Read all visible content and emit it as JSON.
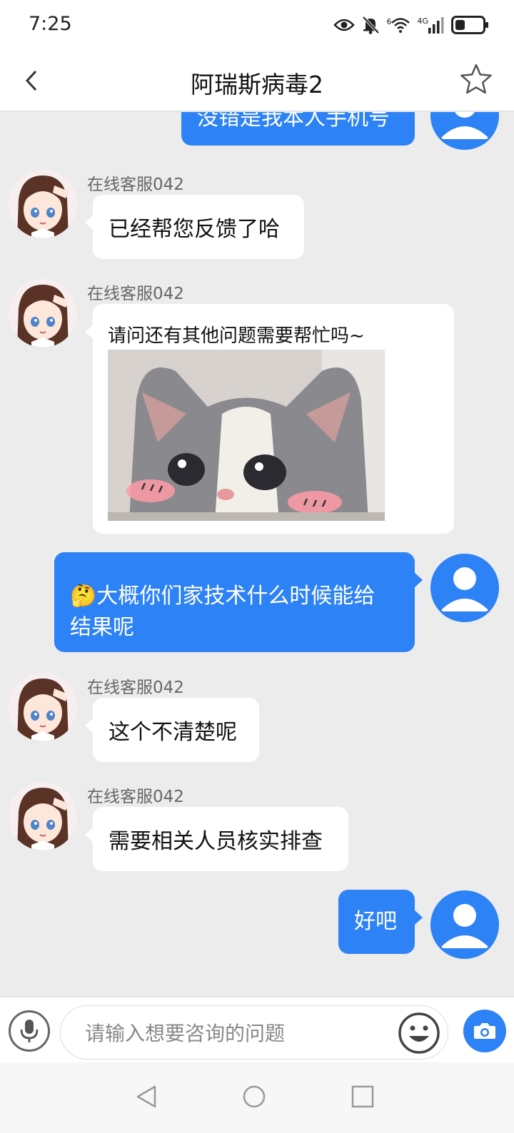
{
  "status_bar": {
    "time": "7:25",
    "signal_label": "4G",
    "wifi_label": "6",
    "battery_level": 0.35
  },
  "header": {
    "title": "阿瑞斯病毒2"
  },
  "messages": [
    {
      "from": "user",
      "text": "没错是我本人手机号",
      "partial": true
    },
    {
      "from": "agent",
      "sender": "在线客服042",
      "text": "已经帮您反馈了哈"
    },
    {
      "from": "agent",
      "sender": "在线客服042",
      "text": "请问还有其他问题需要帮忙吗~",
      "image": "crying-cat-sticker"
    },
    {
      "from": "user",
      "emoji": "🤔",
      "text_line1": "大概你们家技术什么时候能给",
      "text_line2": "结果呢"
    },
    {
      "from": "agent",
      "sender": "在线客服042",
      "text": "这个不清楚呢"
    },
    {
      "from": "agent",
      "sender": "在线客服042",
      "text": "需要相关人员核实排查"
    },
    {
      "from": "user",
      "text": "好吧"
    }
  ],
  "input": {
    "placeholder": "请输入想要咨询的问题",
    "value": ""
  },
  "colors": {
    "accent": "#2d82f5",
    "background": "#ececec"
  }
}
